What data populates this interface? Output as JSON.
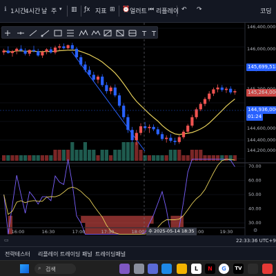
{
  "toolbar": {
    "interval_1h": "1시간",
    "interval_4h": "4시간",
    "interval_day": "날",
    "interval_week": "주",
    "indicators": "지표",
    "alert": "얼러트",
    "replay": "리플레이",
    "right_label": "코딩"
  },
  "price_axis": {
    "ticks": [
      "146,400,000",
      "146,000,000",
      "145,600,000",
      "145,200,000",
      "144,800,000",
      "144,600,000",
      "144,400,000",
      "144,200,000"
    ],
    "current_price": "145,699,518",
    "sub_price": "145,264,000",
    "last_price": "144,936,000",
    "countdown": "01:24"
  },
  "osc_axis": {
    "ticks": [
      "70.00",
      "60.00",
      "50.00",
      "40.00",
      "30.00"
    ]
  },
  "time_axis": {
    "ticks": [
      "16:00",
      "16:30",
      "17:00",
      "17:30",
      "18:00",
      "19:00",
      "19:30"
    ],
    "crosshair_label": "수 2025-05-14  18:35"
  },
  "status": {
    "clock": "22:33:36 UTC+9"
  },
  "panel_tabs": [
    "전략테스터",
    "리플레이 트레이딩 패널",
    "트레이딩패널"
  ],
  "taskbar": {
    "search_label": "검색"
  },
  "colors": {
    "up": "#ef5350",
    "down": "#2962ff",
    "ma": "#e6cf5a",
    "oscillator": "#7b61ff"
  },
  "chart_data": {
    "type": "candlestick",
    "interval": "5m",
    "y_unit": "KRW",
    "ylim": [
      144140000,
      146420000
    ],
    "candles": [
      {
        "o": 145930000,
        "h": 145990000,
        "l": 145890000,
        "c": 145960000,
        "vol": "low"
      },
      {
        "o": 145960000,
        "h": 146030000,
        "l": 145910000,
        "c": 145920000,
        "vol": "low"
      },
      {
        "o": 145920000,
        "h": 145970000,
        "l": 145860000,
        "c": 145950000,
        "vol": "low"
      },
      {
        "o": 145950000,
        "h": 146010000,
        "l": 145900000,
        "c": 145990000,
        "vol": "low"
      },
      {
        "o": 145990000,
        "h": 146050000,
        "l": 145940000,
        "c": 145960000,
        "vol": "low"
      },
      {
        "o": 145960000,
        "h": 146000000,
        "l": 145880000,
        "c": 145910000,
        "vol": "low"
      },
      {
        "o": 145910000,
        "h": 145980000,
        "l": 145870000,
        "c": 145970000,
        "vol": "low"
      },
      {
        "o": 145970000,
        "h": 146040000,
        "l": 145930000,
        "c": 145950000,
        "vol": "low"
      },
      {
        "o": 145950000,
        "h": 145990000,
        "l": 145860000,
        "c": 145880000,
        "vol": "low"
      },
      {
        "o": 145880000,
        "h": 145960000,
        "l": 145840000,
        "c": 145940000,
        "vol": "low"
      },
      {
        "o": 145940000,
        "h": 146000000,
        "l": 145900000,
        "c": 145980000,
        "vol": "low"
      },
      {
        "o": 145980000,
        "h": 146020000,
        "l": 145910000,
        "c": 145930000,
        "vol": "low"
      },
      {
        "o": 145930000,
        "h": 146040000,
        "l": 145900000,
        "c": 146010000,
        "vol": "mid"
      },
      {
        "o": 146010000,
        "h": 146070000,
        "l": 145960000,
        "c": 146030000,
        "vol": "mid"
      },
      {
        "o": 146030000,
        "h": 146080000,
        "l": 145980000,
        "c": 146000000,
        "vol": "mid"
      },
      {
        "o": 146000000,
        "h": 146060000,
        "l": 145980000,
        "c": 146050000,
        "vol": "mid"
      },
      {
        "o": 146050000,
        "h": 146090000,
        "l": 145970000,
        "c": 145990000,
        "vol": "high"
      },
      {
        "o": 145990000,
        "h": 146020000,
        "l": 145820000,
        "c": 145850000,
        "vol": "mid"
      },
      {
        "o": 145850000,
        "h": 145890000,
        "l": 145700000,
        "c": 145730000,
        "vol": "mid"
      },
      {
        "o": 145730000,
        "h": 145780000,
        "l": 145600000,
        "c": 145640000,
        "vol": "high"
      },
      {
        "o": 145640000,
        "h": 145700000,
        "l": 145530000,
        "c": 145560000,
        "vol": "mid"
      },
      {
        "o": 145560000,
        "h": 145610000,
        "l": 145450000,
        "c": 145480000,
        "vol": "mid"
      },
      {
        "o": 145480000,
        "h": 145560000,
        "l": 145420000,
        "c": 145530000,
        "vol": "low"
      },
      {
        "o": 145530000,
        "h": 145570000,
        "l": 145360000,
        "c": 145390000,
        "vol": "mid"
      },
      {
        "o": 145390000,
        "h": 145440000,
        "l": 145250000,
        "c": 145290000,
        "vol": "mid"
      },
      {
        "o": 145290000,
        "h": 145380000,
        "l": 145240000,
        "c": 145350000,
        "vol": "low"
      },
      {
        "o": 145350000,
        "h": 145400000,
        "l": 145190000,
        "c": 145220000,
        "vol": "mid"
      },
      {
        "o": 145220000,
        "h": 145260000,
        "l": 145020000,
        "c": 145050000,
        "vol": "mid"
      },
      {
        "o": 145050000,
        "h": 145090000,
        "l": 144820000,
        "c": 144860000,
        "vol": "high"
      },
      {
        "o": 144860000,
        "h": 144910000,
        "l": 144600000,
        "c": 144650000,
        "vol": "high"
      },
      {
        "o": 144650000,
        "h": 144700000,
        "l": 144440000,
        "c": 144480000,
        "vol": "high"
      },
      {
        "o": 144480000,
        "h": 144650000,
        "l": 144400000,
        "c": 144600000,
        "vol": "high"
      },
      {
        "o": 144600000,
        "h": 144760000,
        "l": 144560000,
        "c": 144710000,
        "vol": "mid"
      },
      {
        "o": 144710000,
        "h": 144780000,
        "l": 144640000,
        "c": 144680000,
        "vol": "low"
      },
      {
        "o": 144680000,
        "h": 144740000,
        "l": 144600000,
        "c": 144700000,
        "vol": "low"
      },
      {
        "o": 144700000,
        "h": 144740000,
        "l": 144630000,
        "c": 144660000,
        "vol": "low"
      },
      {
        "o": 144660000,
        "h": 144700000,
        "l": 144560000,
        "c": 144580000,
        "vol": "low"
      },
      {
        "o": 144580000,
        "h": 144620000,
        "l": 144470000,
        "c": 144500000,
        "vol": "low"
      },
      {
        "o": 144500000,
        "h": 144560000,
        "l": 144440000,
        "c": 144520000,
        "vol": "low"
      },
      {
        "o": 144520000,
        "h": 144580000,
        "l": 144440000,
        "c": 144470000,
        "vol": "mid"
      },
      {
        "o": 144470000,
        "h": 144520000,
        "l": 144400000,
        "c": 144450000,
        "vol": "mid"
      },
      {
        "o": 144450000,
        "h": 144560000,
        "l": 144420000,
        "c": 144530000,
        "vol": "mid"
      },
      {
        "o": 144530000,
        "h": 144650000,
        "l": 144500000,
        "c": 144620000,
        "vol": "low"
      },
      {
        "o": 144620000,
        "h": 144750000,
        "l": 144590000,
        "c": 144720000,
        "vol": "low"
      },
      {
        "o": 144720000,
        "h": 144900000,
        "l": 144690000,
        "c": 144860000,
        "vol": "mid"
      },
      {
        "o": 144860000,
        "h": 145020000,
        "l": 144830000,
        "c": 144990000,
        "vol": "mid"
      },
      {
        "o": 144990000,
        "h": 145110000,
        "l": 144960000,
        "c": 145080000,
        "vol": "mid"
      },
      {
        "o": 145080000,
        "h": 145190000,
        "l": 145040000,
        "c": 145160000,
        "vol": "low"
      },
      {
        "o": 145160000,
        "h": 145290000,
        "l": 145120000,
        "c": 145250000,
        "vol": "low"
      },
      {
        "o": 145250000,
        "h": 145350000,
        "l": 145210000,
        "c": 145320000,
        "vol": "low"
      },
      {
        "o": 145320000,
        "h": 145400000,
        "l": 145270000,
        "c": 145350000,
        "vol": "low"
      },
      {
        "o": 145350000,
        "h": 145390000,
        "l": 145280000,
        "c": 145310000,
        "vol": "low"
      },
      {
        "o": 145310000,
        "h": 145360000,
        "l": 145260000,
        "c": 145330000,
        "vol": "low"
      },
      {
        "o": 145330000,
        "h": 145370000,
        "l": 145240000,
        "c": 145270000,
        "vol": "low"
      },
      {
        "o": 145270000,
        "h": 145320000,
        "l": 145230000,
        "c": 145290000,
        "vol": "low"
      }
    ]
  }
}
